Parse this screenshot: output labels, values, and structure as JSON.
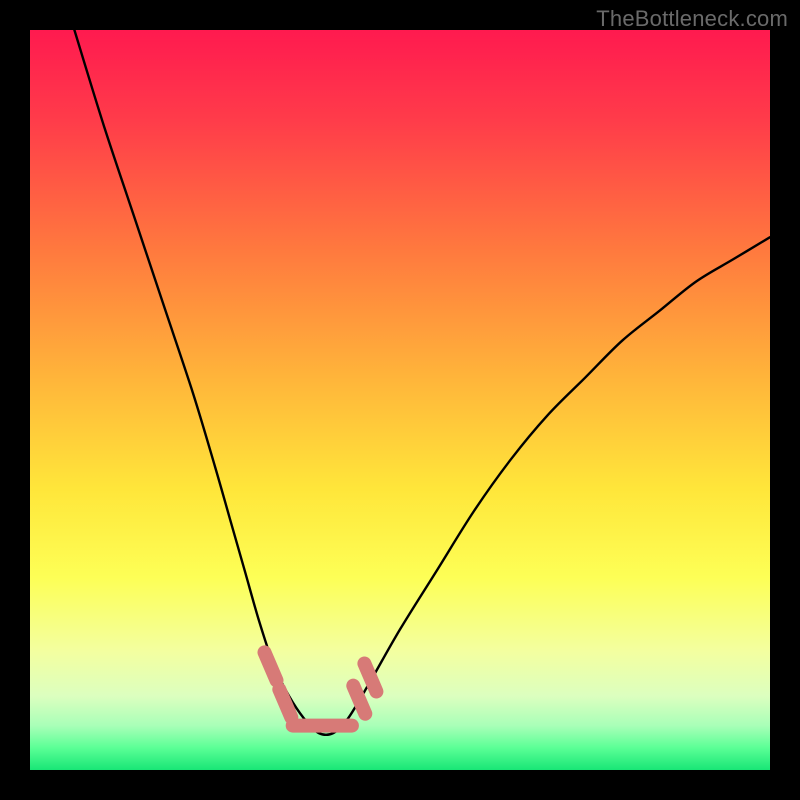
{
  "watermark": "TheBottleneck.com",
  "chart_data": {
    "type": "line",
    "title": "",
    "xlabel": "",
    "ylabel": "",
    "xlim": [
      0,
      100
    ],
    "ylim": [
      0,
      100
    ],
    "series": [
      {
        "name": "bottleneck-curve",
        "x": [
          6,
          10,
          14,
          18,
          22,
          25,
          27,
          29,
          31,
          33,
          35,
          37,
          39,
          41,
          43,
          46,
          50,
          55,
          60,
          65,
          70,
          75,
          80,
          85,
          90,
          95,
          100
        ],
        "values": [
          100,
          87,
          75,
          63,
          51,
          41,
          34,
          27,
          20,
          14,
          10,
          7,
          5,
          5,
          7,
          12,
          19,
          27,
          35,
          42,
          48,
          53,
          58,
          62,
          66,
          69,
          72
        ]
      }
    ],
    "markers": [
      {
        "name": "marker-left-upper",
        "x": 32.5,
        "y": 14,
        "color": "#d77a77"
      },
      {
        "name": "marker-left-lower",
        "x": 34.5,
        "y": 9,
        "color": "#d77a77"
      },
      {
        "name": "marker-right-upper",
        "x": 44.5,
        "y": 9.5,
        "color": "#d77a77"
      },
      {
        "name": "marker-right-lower",
        "x": 46,
        "y": 12.5,
        "color": "#d77a77"
      }
    ],
    "bottom_band": {
      "name": "bottom-segment",
      "x_start": 35.5,
      "x_end": 43.5,
      "y": 6,
      "color": "#d77a77"
    },
    "background_gradient": {
      "stops": [
        {
          "offset": 0.0,
          "color": "#ff1a4f"
        },
        {
          "offset": 0.12,
          "color": "#ff3b4a"
        },
        {
          "offset": 0.3,
          "color": "#ff7a3e"
        },
        {
          "offset": 0.48,
          "color": "#ffb83a"
        },
        {
          "offset": 0.62,
          "color": "#ffe63a"
        },
        {
          "offset": 0.74,
          "color": "#fdff56"
        },
        {
          "offset": 0.84,
          "color": "#f3ffa0"
        },
        {
          "offset": 0.9,
          "color": "#dcffbf"
        },
        {
          "offset": 0.94,
          "color": "#a9ffb8"
        },
        {
          "offset": 0.97,
          "color": "#5bff96"
        },
        {
          "offset": 1.0,
          "color": "#18e676"
        }
      ]
    }
  }
}
